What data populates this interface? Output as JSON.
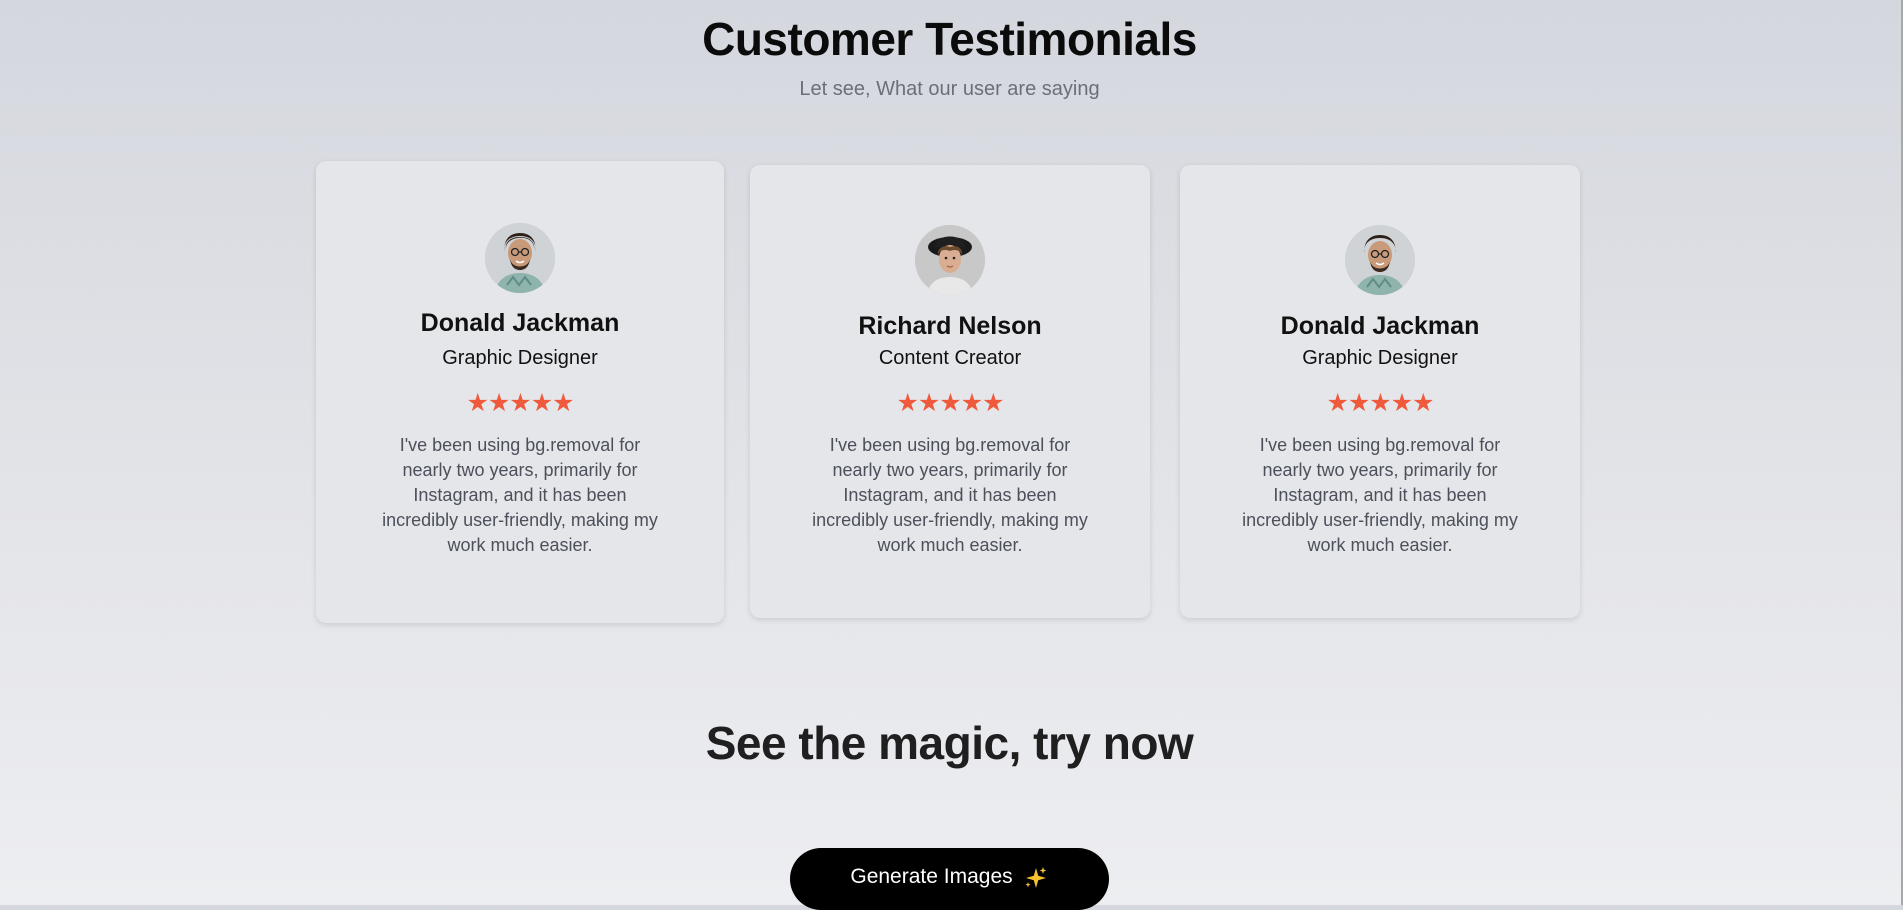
{
  "section": {
    "title": "Customer Testimonials",
    "subtitle": "Let see, What our user are saying"
  },
  "testimonials": [
    {
      "name": "Donald Jackman",
      "role": "Graphic Designer",
      "rating": 5,
      "stars": "★★★★★",
      "quote": "I've been using bg.removal for nearly two years, primarily for Instagram, and it has been incredibly user-friendly, making my work much easier."
    },
    {
      "name": "Richard Nelson",
      "role": "Content Creator",
      "rating": 5,
      "stars": "★★★★★",
      "quote": "I've been using bg.removal for nearly two years, primarily for Instagram, and it has been incredibly user-friendly, making my work much easier."
    },
    {
      "name": "Donald Jackman",
      "role": "Graphic Designer",
      "rating": 5,
      "stars": "★★★★★",
      "quote": "I've been using bg.removal for nearly two years, primarily for Instagram, and it has been incredibly user-friendly, making my work much easier."
    }
  ],
  "cta": {
    "title": "See the magic, try now",
    "button_label": "Generate Images",
    "button_icon": "sparkles-icon"
  },
  "colors": {
    "star": "#ef5a3c",
    "button_bg": "#000000",
    "subtitle": "#6b6f78",
    "quote_text": "#4b505a"
  }
}
